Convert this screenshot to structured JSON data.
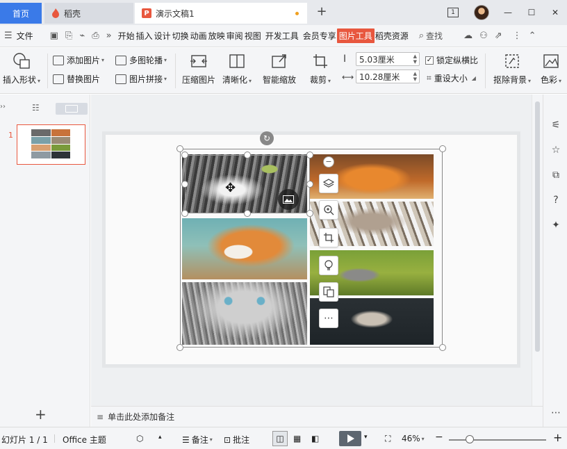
{
  "tabs": {
    "home": "首页",
    "daoke": "稻壳",
    "doc": "演示文稿1",
    "add": "+"
  },
  "window": {
    "pages_badge": "1",
    "minimize": "—",
    "maximize": "☐",
    "close": "✕"
  },
  "menu": {
    "file": "文件",
    "items": [
      "开始",
      "插入",
      "设计",
      "切换",
      "动画",
      "放映",
      "审阅",
      "视图",
      "开发工具",
      "会员专享"
    ],
    "active": "图片工具",
    "after": "稻壳资源",
    "search": "查找"
  },
  "ribbon": {
    "insert_shape": "插入形状",
    "add_picture": "添加图片",
    "replace_picture": "替换图片",
    "multi_carousel": "多图轮播",
    "picture_join": "图片拼接",
    "compress": "压缩图片",
    "sharpen": "清晰化",
    "smart_scale": "智能缩放",
    "crop": "裁剪",
    "height_value": "5.03厘米",
    "width_value": "10.28厘米",
    "lock_ratio": "锁定纵横比",
    "reset_size": "重设大小",
    "remove_bg": "抠除背景",
    "color": "色彩"
  },
  "left_panel": {
    "slide_number": "1",
    "add": "+"
  },
  "notes": {
    "placeholder": "单击此处添加备注"
  },
  "status": {
    "slide_info": "幻灯片 1 / 1",
    "theme": "Office 主题",
    "notes": "备注",
    "comments": "批注",
    "zoom": "46%",
    "zoom_level": 0.46
  },
  "colors": {
    "accent": "#e8573e",
    "home_tab": "#3a7ae8"
  }
}
